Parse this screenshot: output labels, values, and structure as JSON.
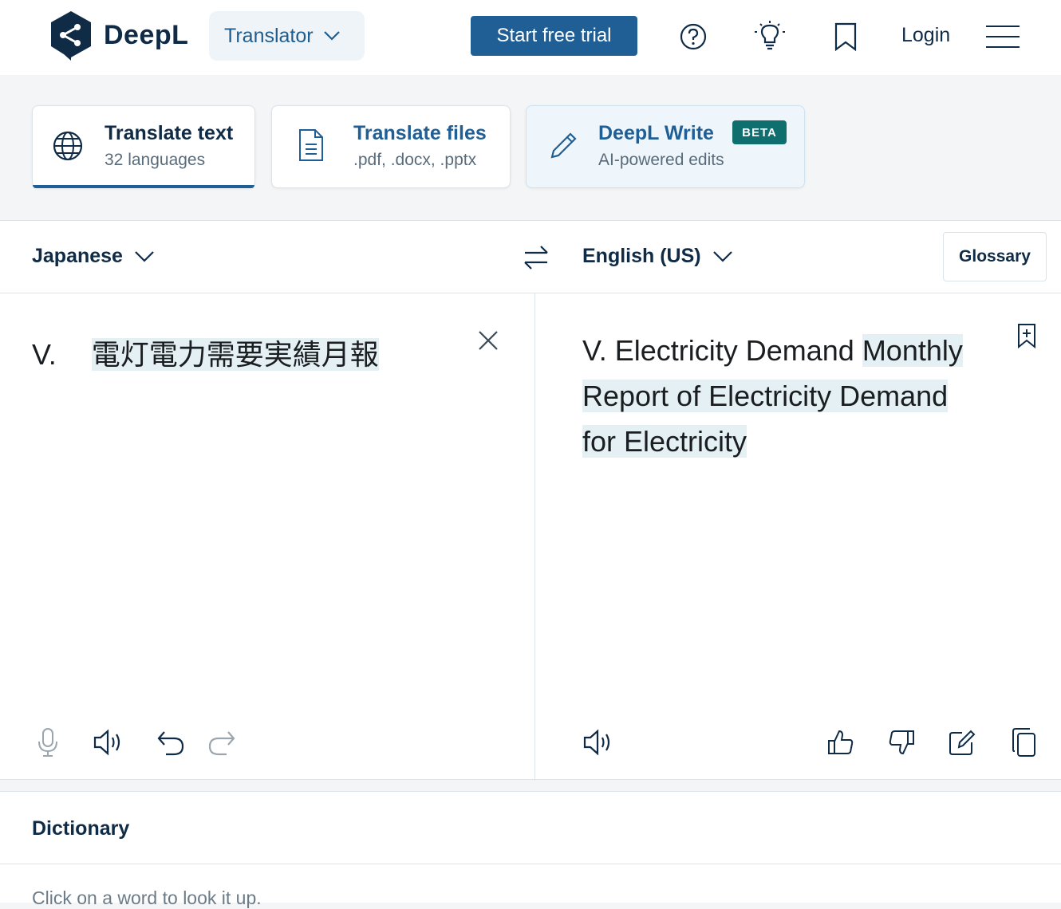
{
  "header": {
    "brand": "DeepL",
    "product": "Translator",
    "trial_button": "Start free trial",
    "login": "Login"
  },
  "tabs": [
    {
      "title": "Translate text",
      "subtitle": "32 languages",
      "icon": "globe-icon",
      "active": true
    },
    {
      "title": "Translate files",
      "subtitle": ".pdf, .docx, .pptx",
      "icon": "document-icon",
      "active": false
    },
    {
      "title": "DeepL Write",
      "subtitle": "AI-powered edits",
      "badge": "BETA",
      "icon": "pencil-icon",
      "active": false
    }
  ],
  "translator": {
    "source_language": "Japanese",
    "target_language": "English (US)",
    "glossary": "Glossary",
    "source_prefix": "V.",
    "source_highlight": "電灯電力需要実績月報",
    "target_plain": "V. Electricity Demand ",
    "target_highlight_1": "Monthly",
    "target_highlight_2": "Report of Electricity Demand",
    "target_highlight_3": "for Electricity"
  },
  "dictionary": {
    "title": "Dictionary",
    "hint": "Click on a word to look it up."
  },
  "colors": {
    "brand_navy": "#0f2b46",
    "accent_blue": "#1f5f95",
    "beta_teal": "#0f6e6e",
    "highlight": "#e4f0f4"
  }
}
